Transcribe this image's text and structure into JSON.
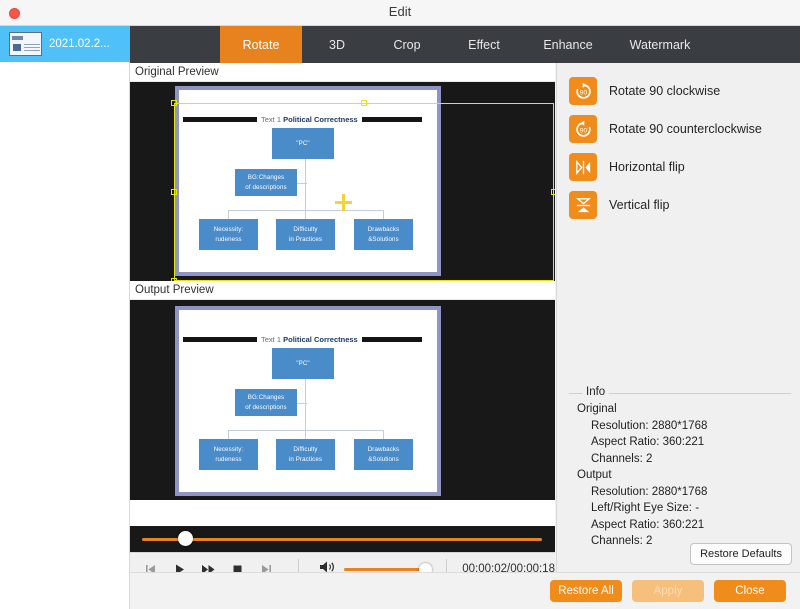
{
  "window": {
    "title": "Edit",
    "close_icon": "close-dot-icon"
  },
  "sidebar": {
    "items": [
      {
        "label": "2021.02.2...",
        "thumbnail_icon": "slide-thumbnail-icon",
        "selected": true
      }
    ]
  },
  "tabs": [
    {
      "label": "Rotate",
      "active": true
    },
    {
      "label": "3D",
      "active": false
    },
    {
      "label": "Crop",
      "active": false
    },
    {
      "label": "Effect",
      "active": false
    },
    {
      "label": "Enhance",
      "active": false
    },
    {
      "label": "Watermark",
      "active": false
    }
  ],
  "previews": {
    "original_label": "Original Preview",
    "output_label": "Output Preview"
  },
  "slide": {
    "header_prefix": "Text 1",
    "header_title": "Political Correctness",
    "root": "\"PC\"",
    "branch": [
      "BG:Changes",
      "of descriptions"
    ],
    "leaves": [
      [
        "Necessity:",
        "rudeness"
      ],
      [
        "Difficulty",
        "in Practices"
      ],
      [
        "Drawbacks",
        "&Solutions"
      ]
    ]
  },
  "operations": [
    {
      "label": "Rotate 90 clockwise",
      "icon": "rotate-cw-90-icon"
    },
    {
      "label": "Rotate 90 counterclockwise",
      "icon": "rotate-ccw-90-icon"
    },
    {
      "label": "Horizontal flip",
      "icon": "horizontal-flip-icon"
    },
    {
      "label": "Vertical flip",
      "icon": "vertical-flip-icon"
    }
  ],
  "transport": {
    "prev_icon": "skip-previous-icon",
    "play_icon": "play-icon",
    "forward_icon": "fast-forward-icon",
    "stop_icon": "stop-icon",
    "next_icon": "skip-next-icon",
    "volume_icon": "volume-icon",
    "time": "00:00:02/00:00:18",
    "progress_percent": 9,
    "volume_percent": 100
  },
  "info": {
    "legend": "Info",
    "original_group": "Original",
    "original": [
      "Resolution: 2880*1768",
      "Aspect Ratio: 360:221",
      "Channels: 2"
    ],
    "output_group": "Output",
    "output": [
      "Resolution: 2880*1768",
      "Left/Right Eye Size: -",
      "Aspect Ratio: 360:221",
      "Channels: 2"
    ],
    "restore_defaults_label": "Restore Defaults"
  },
  "footer": {
    "restore_all_label": "Restore All",
    "apply_label": "Apply",
    "apply_enabled": false,
    "close_label": "Close"
  },
  "colors": {
    "accent": "#ef8c1c",
    "tab_active": "#e8821e",
    "tabbar_bg": "#3a3d42",
    "sidebar_selected": "#4fc0f8",
    "selection_handle": "#e6e413",
    "node_blue": "#4a8bc9",
    "stage_bg": "#181818"
  }
}
